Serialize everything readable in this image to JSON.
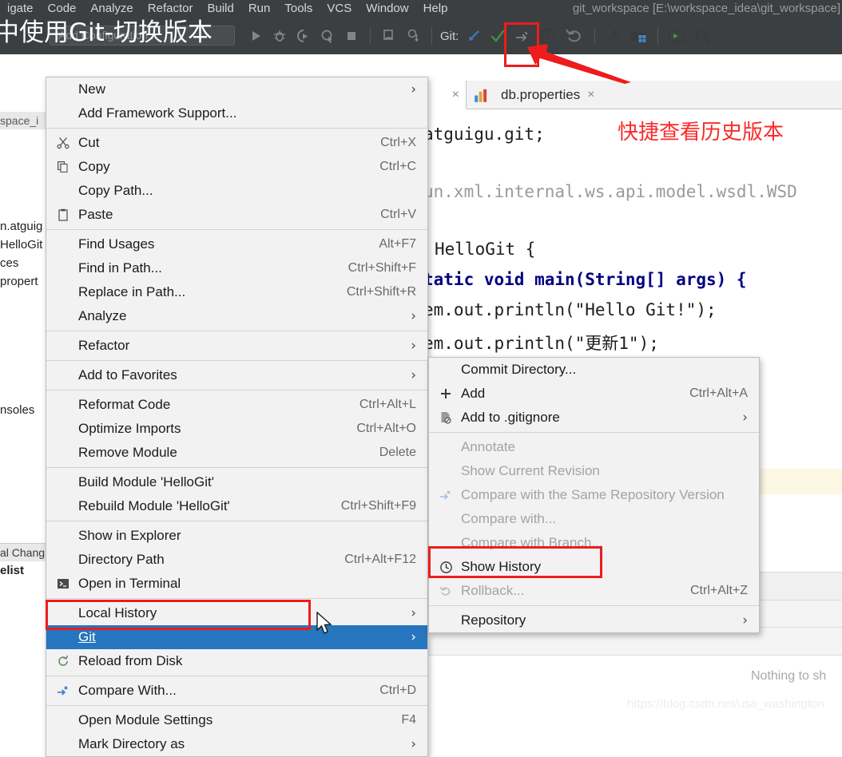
{
  "window": {
    "project_title": "git_workspace [E:\\workspace_idea\\git_workspace]",
    "overlay_title": "中使用Git-切换版本",
    "menubar": [
      "igate",
      "Code",
      "Analyze",
      "Refactor",
      "Build",
      "Run",
      "Tools",
      "VCS",
      "Window",
      "Help"
    ]
  },
  "toolbar": {
    "run_config_placeholder": "Add Configuration...",
    "git_label": "Git:",
    "icons": [
      "run-icon",
      "debug-icon",
      "run-with-coverage-icon",
      "profile-icon",
      "stop-icon",
      "update-project-icon",
      "pull-icon",
      "commit-icon",
      "checkmark-icon",
      "compare-icon",
      "show-history-icon",
      "rollback-icon",
      "settings-wrench-icon",
      "project-structure-icon",
      "select-target-icon",
      "search-everywhere-icon"
    ]
  },
  "sidebar": {
    "header": "space_i",
    "rows": [
      "n.atguig",
      "HelloGit",
      "ces",
      "propert",
      "nsoles"
    ],
    "bottom_bar": "al Chang",
    "bottom_bold": "elist"
  },
  "editor": {
    "tabs": [
      {
        "label": "",
        "icon": "java-file-icon",
        "close": "×",
        "active": true
      },
      {
        "label": "db.properties",
        "icon": "properties-file-icon",
        "close": "×",
        "active": false
      }
    ],
    "code_lines": [
      {
        "text": "atguigu.git;",
        "type": "plain"
      },
      {
        "text": "un.xml.internal.ws.api.model.wsdl.WSD",
        "type": "greyed"
      },
      {
        "text": "HelloGit {",
        "type": "plain"
      },
      {
        "text": "tatic void main(String[] args) {",
        "type": "signature"
      },
      {
        "text": "em.out.println(\"Hello Git!\");",
        "type": "statement1"
      },
      {
        "text": "em.out.println(\"更新1\");",
        "type": "statement2"
      }
    ],
    "nothing_to_show": "Nothing to sh",
    "watermark": "https://blog.csdn.net/usa_washington"
  },
  "annotations": {
    "red_note": "快捷查看历史版本",
    "red_box_toolbar": "show-history-toolbar-button",
    "red_box_git": "git-menu-item",
    "red_box_history": "show-history-menu-item",
    "arrow_color": "#ee1c1c"
  },
  "context_menu": {
    "items": [
      {
        "label": "New",
        "accel": "",
        "arrow": true,
        "icon": "",
        "sep_after": false
      },
      {
        "label": "Add Framework Support...",
        "accel": "",
        "arrow": false,
        "icon": "",
        "sep_after": true
      },
      {
        "label": "Cut",
        "accel": "Ctrl+X",
        "arrow": false,
        "icon": "scissors-icon",
        "sep_after": false
      },
      {
        "label": "Copy",
        "accel": "Ctrl+C",
        "arrow": false,
        "icon": "copy-icon",
        "sep_after": false
      },
      {
        "label": "Copy Path...",
        "accel": "",
        "arrow": false,
        "icon": "",
        "sep_after": false
      },
      {
        "label": "Paste",
        "accel": "Ctrl+V",
        "arrow": false,
        "icon": "paste-icon",
        "sep_after": true
      },
      {
        "label": "Find Usages",
        "accel": "Alt+F7",
        "arrow": false,
        "icon": "",
        "sep_after": false
      },
      {
        "label": "Find in Path...",
        "accel": "Ctrl+Shift+F",
        "arrow": false,
        "icon": "",
        "sep_after": false
      },
      {
        "label": "Replace in Path...",
        "accel": "Ctrl+Shift+R",
        "arrow": false,
        "icon": "",
        "sep_after": false
      },
      {
        "label": "Analyze",
        "accel": "",
        "arrow": true,
        "icon": "",
        "sep_after": true
      },
      {
        "label": "Refactor",
        "accel": "",
        "arrow": true,
        "icon": "",
        "sep_after": true
      },
      {
        "label": "Add to Favorites",
        "accel": "",
        "arrow": true,
        "icon": "",
        "sep_after": true
      },
      {
        "label": "Reformat Code",
        "accel": "Ctrl+Alt+L",
        "arrow": false,
        "icon": "",
        "sep_after": false
      },
      {
        "label": "Optimize Imports",
        "accel": "Ctrl+Alt+O",
        "arrow": false,
        "icon": "",
        "sep_after": false
      },
      {
        "label": "Remove Module",
        "accel": "Delete",
        "arrow": false,
        "icon": "",
        "sep_after": true
      },
      {
        "label": "Build Module 'HelloGit'",
        "accel": "",
        "arrow": false,
        "icon": "",
        "sep_after": false
      },
      {
        "label": "Rebuild Module 'HelloGit'",
        "accel": "Ctrl+Shift+F9",
        "arrow": false,
        "icon": "",
        "sep_after": true
      },
      {
        "label": "Show in Explorer",
        "accel": "",
        "arrow": false,
        "icon": "",
        "sep_after": false
      },
      {
        "label": "Directory Path",
        "accel": "Ctrl+Alt+F12",
        "arrow": false,
        "icon": "",
        "sep_after": false
      },
      {
        "label": "Open in Terminal",
        "accel": "",
        "arrow": false,
        "icon": "terminal-icon",
        "sep_after": true
      },
      {
        "label": "Local History",
        "accel": "",
        "arrow": true,
        "icon": "",
        "sep_after": false
      },
      {
        "label": "Git",
        "accel": "",
        "arrow": true,
        "icon": "",
        "sep_after": false,
        "selected": true
      },
      {
        "label": "Reload from Disk",
        "accel": "",
        "arrow": false,
        "icon": "reload-icon",
        "sep_after": true
      },
      {
        "label": "Compare With...",
        "accel": "Ctrl+D",
        "arrow": false,
        "icon": "compare-icon",
        "sep_after": true
      },
      {
        "label": "Open Module Settings",
        "accel": "F4",
        "arrow": false,
        "icon": "",
        "sep_after": false
      },
      {
        "label": "Mark Directory as",
        "accel": "",
        "arrow": true,
        "icon": "",
        "sep_after": false
      }
    ]
  },
  "submenu": {
    "items": [
      {
        "label": "Commit Directory...",
        "accel": "",
        "arrow": false,
        "icon": "",
        "disabled": false,
        "sep_after": false
      },
      {
        "label": "Add",
        "accel": "Ctrl+Alt+A",
        "arrow": false,
        "icon": "plus-icon",
        "disabled": false,
        "sep_after": false
      },
      {
        "label": "Add to .gitignore",
        "accel": "",
        "arrow": true,
        "icon": "gitignore-icon",
        "disabled": false,
        "sep_after": true
      },
      {
        "label": "Annotate",
        "accel": "",
        "arrow": false,
        "icon": "",
        "disabled": true,
        "sep_after": false
      },
      {
        "label": "Show Current Revision",
        "accel": "",
        "arrow": false,
        "icon": "",
        "disabled": true,
        "sep_after": false
      },
      {
        "label": "Compare with the Same Repository Version",
        "accel": "",
        "arrow": false,
        "icon": "compare-icon",
        "disabled": true,
        "sep_after": false
      },
      {
        "label": "Compare with...",
        "accel": "",
        "arrow": false,
        "icon": "",
        "disabled": true,
        "sep_after": false
      },
      {
        "label": "Compare with Branch...",
        "accel": "",
        "arrow": false,
        "icon": "",
        "disabled": true,
        "sep_after": false
      },
      {
        "label": "Show History",
        "accel": "",
        "arrow": false,
        "icon": "clock-icon",
        "disabled": false,
        "sep_after": false
      },
      {
        "label": "Rollback...",
        "accel": "Ctrl+Alt+Z",
        "arrow": false,
        "icon": "rollback-icon",
        "disabled": true,
        "sep_after": true
      },
      {
        "label": "Repository",
        "accel": "",
        "arrow": true,
        "icon": "",
        "disabled": false,
        "sep_after": false
      }
    ]
  }
}
